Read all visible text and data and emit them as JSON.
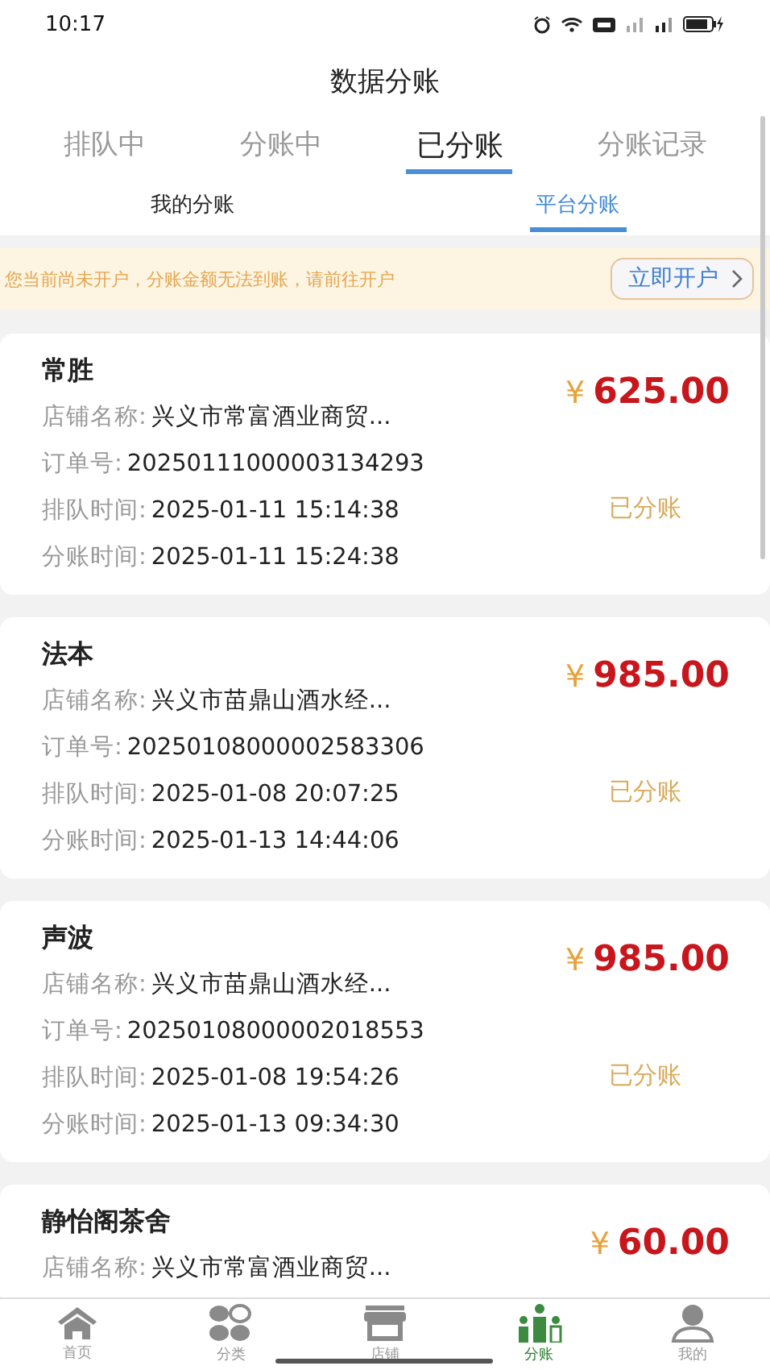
{
  "status_bar": {
    "time": "10:17"
  },
  "title": "数据分账",
  "tabs": [
    {
      "label": "排队中",
      "selected": false
    },
    {
      "label": "分账中",
      "selected": false
    },
    {
      "label": "已分账",
      "selected": true
    },
    {
      "label": "分账记录",
      "selected": false
    }
  ],
  "sub_tabs": [
    {
      "label": "我的分账",
      "selected": false
    },
    {
      "label": "平台分账",
      "selected": true
    }
  ],
  "notice": {
    "text": "您当前尚未开户，分账金额无法到账，请前往开户",
    "button": "立即开户"
  },
  "orders": [
    {
      "name": "常胜",
      "amount": "625.00",
      "currency": "¥",
      "status": "已分账",
      "fields": [
        {
          "label": "店铺名称:",
          "value": "兴义市常富酒业商贸..."
        },
        {
          "label": "订单号:",
          "value": "20250111000003134293"
        },
        {
          "label": "排队时间:",
          "value": "2025-01-11 15:14:38"
        },
        {
          "label": "分账时间:",
          "value": "2025-01-11 15:24:38"
        }
      ]
    },
    {
      "name": "法本",
      "amount": "985.00",
      "currency": "¥",
      "status": "已分账",
      "fields": [
        {
          "label": "店铺名称:",
          "value": "兴义市苗鼎山酒水经..."
        },
        {
          "label": "订单号:",
          "value": "20250108000002583306"
        },
        {
          "label": "排队时间:",
          "value": "2025-01-08 20:07:25"
        },
        {
          "label": "分账时间:",
          "value": "2025-01-13 14:44:06"
        }
      ]
    },
    {
      "name": "声波",
      "amount": "985.00",
      "currency": "¥",
      "status": "已分账",
      "fields": [
        {
          "label": "店铺名称:",
          "value": "兴义市苗鼎山酒水经..."
        },
        {
          "label": "订单号:",
          "value": "20250108000002018553"
        },
        {
          "label": "排队时间:",
          "value": "2025-01-08 19:54:26"
        },
        {
          "label": "分账时间:",
          "value": "2025-01-13 09:34:30"
        }
      ]
    },
    {
      "name": "静怡阁茶舍",
      "amount": "60.00",
      "currency": "¥",
      "fields": [
        {
          "label": "店铺名称:",
          "value": "兴义市常富酒业商贸..."
        }
      ]
    }
  ],
  "bottom_nav": [
    {
      "label": "首页",
      "selected": false
    },
    {
      "label": "分类",
      "selected": false
    },
    {
      "label": "店铺",
      "selected": false
    },
    {
      "label": "分账",
      "selected": true
    },
    {
      "label": "我的",
      "selected": false
    }
  ]
}
